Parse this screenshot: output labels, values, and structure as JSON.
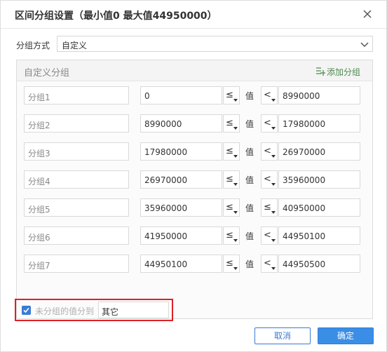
{
  "dialog": {
    "title": "区间分组设置（最小值0 最大值44950000）",
    "mode_label": "分组方式",
    "mode_value": "自定义",
    "panel_title": "自定义分组",
    "add_group_label": "添加分组",
    "value_label": "值",
    "groups": [
      {
        "name": "分组1",
        "from": "0",
        "from_op": "≤",
        "to_op": "<",
        "to": "8990000"
      },
      {
        "name": "分组2",
        "from": "8990000",
        "from_op": "≤",
        "to_op": "<",
        "to": "17980000"
      },
      {
        "name": "分组3",
        "from": "17980000",
        "from_op": "≤",
        "to_op": "<",
        "to": "26970000"
      },
      {
        "name": "分组4",
        "from": "26970000",
        "from_op": "≤",
        "to_op": "<",
        "to": "35960000"
      },
      {
        "name": "分组5",
        "from": "35960000",
        "from_op": "≤",
        "to_op": "≤",
        "to": "40950000"
      },
      {
        "name": "分组6",
        "from": "41950000",
        "from_op": "≤",
        "to_op": "<",
        "to": "44950100"
      },
      {
        "name": "分组7",
        "from": "44950100",
        "from_op": "≤",
        "to_op": "<",
        "to": "44950500"
      }
    ],
    "other": {
      "checked": true,
      "label": "未分组的值分到",
      "value": "其它"
    },
    "cancel_label": "取消",
    "ok_label": "确定"
  },
  "colors": {
    "accent": "#3a8ee6",
    "highlight_border": "#e01f26",
    "add_icon": "#4d8a4d"
  },
  "icons": {
    "close": "close-icon",
    "dropdown": "chevron-down-icon",
    "add": "add-group-icon",
    "check": "check-icon"
  }
}
